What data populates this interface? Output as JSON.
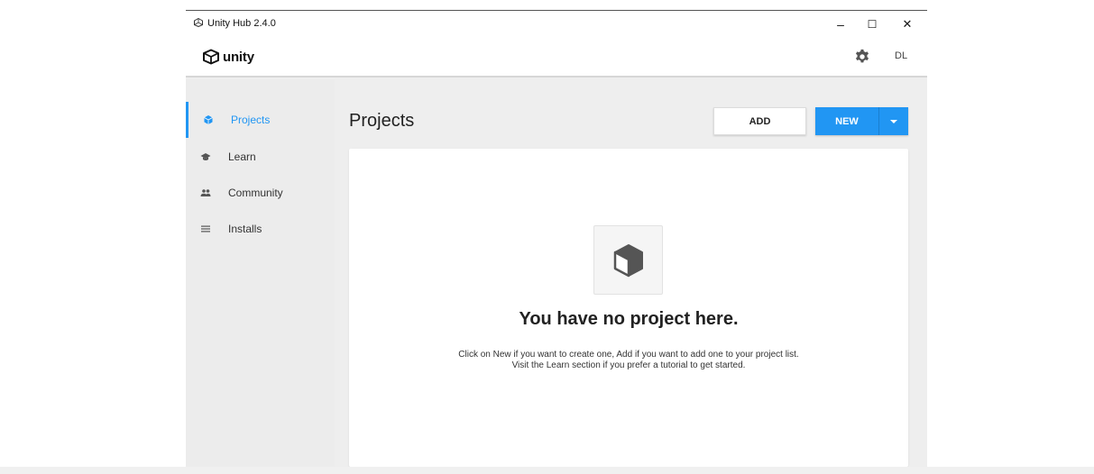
{
  "window": {
    "title": "Unity Hub 2.4.0",
    "controls": {
      "minimize": "–",
      "maximize": "☐",
      "close": "✕"
    }
  },
  "header": {
    "logo_text": "unity",
    "user_initials": "DL",
    "settings_icon": "gear-icon"
  },
  "sidebar": {
    "items": [
      {
        "label": "Projects",
        "icon": "cube-icon",
        "active": true
      },
      {
        "label": "Learn",
        "icon": "graduation-cap-icon",
        "active": false
      },
      {
        "label": "Community",
        "icon": "people-icon",
        "active": false
      },
      {
        "label": "Installs",
        "icon": "list-icon",
        "active": false
      }
    ]
  },
  "main": {
    "title": "Projects",
    "add_label": "ADD",
    "new_label": "NEW",
    "empty_state": {
      "title": "You have no project here.",
      "description": "Click on New if you want to create one, Add if you want to add one to your project list. Visit the Learn section if you prefer a tutorial to get started."
    }
  },
  "colors": {
    "accent": "#2196f3",
    "sidebar_bg": "#ececec",
    "card_bg": "#ffffff"
  }
}
